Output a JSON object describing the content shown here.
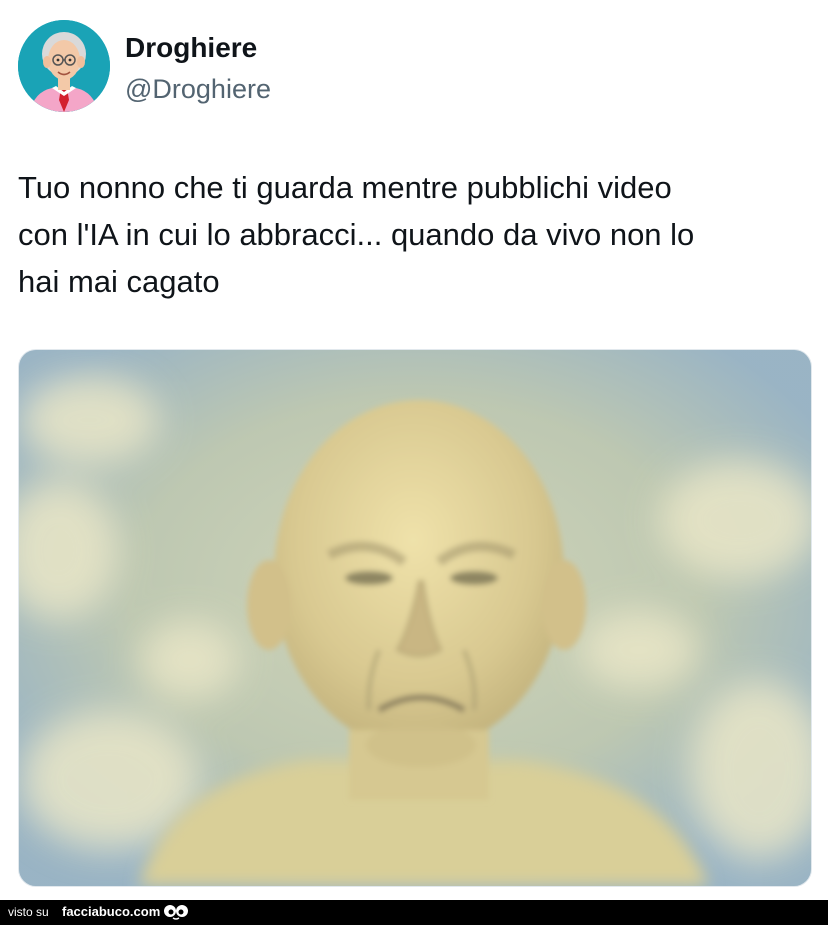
{
  "author": {
    "display_name": "Droghiere",
    "handle": "@Droghiere",
    "avatar_icon": "cartoon-old-man-avatar"
  },
  "tweet": {
    "text": "Tuo nonno che ti guarda mentre pubblichi video\ncon l'IA in cui lo abbracci... quando da vivo non lo\nhai mai cagato"
  },
  "media": {
    "subject": "frowning-old-man-in-clouds-icon"
  },
  "footer": {
    "prefix": "visto su",
    "site": "facciabuco.com",
    "logo_icon": "eyes-logo-icon"
  },
  "colors": {
    "avatar_bg": "#1aa3b6",
    "text": "#0f1419",
    "handle": "#536471",
    "footer_bg": "#000000"
  }
}
